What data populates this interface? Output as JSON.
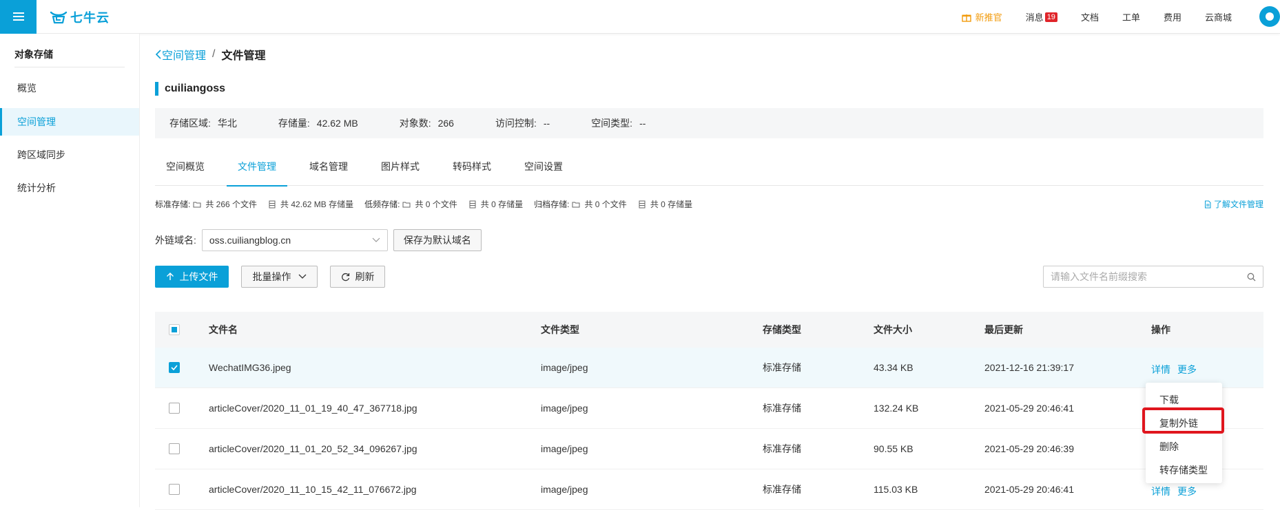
{
  "header": {
    "logo_text": "七牛云",
    "nav": [
      {
        "label": "新推官",
        "promo": true
      },
      {
        "label": "消息",
        "badge": "19"
      },
      {
        "label": "文档"
      },
      {
        "label": "工单"
      },
      {
        "label": "费用"
      },
      {
        "label": "云商城"
      }
    ]
  },
  "sidebar": {
    "title": "对象存储",
    "items": [
      {
        "label": "概览",
        "active": false
      },
      {
        "label": "空间管理",
        "active": true
      },
      {
        "label": "跨区域同步",
        "active": false
      },
      {
        "label": "统计分析",
        "active": false
      }
    ]
  },
  "breadcrumb": {
    "parent": "空间管理",
    "separator": "/",
    "current": "文件管理"
  },
  "bucket": {
    "name": "cuiliangoss",
    "info": [
      {
        "label": "存储区域:",
        "value": "华北"
      },
      {
        "label": "存储量:",
        "value": "42.62 MB"
      },
      {
        "label": "对象数:",
        "value": "266"
      },
      {
        "label": "访问控制:",
        "value": "--"
      },
      {
        "label": "空间类型:",
        "value": "--"
      }
    ]
  },
  "tabs": [
    {
      "label": "空间概览",
      "active": false
    },
    {
      "label": "文件管理",
      "active": true
    },
    {
      "label": "域名管理",
      "active": false
    },
    {
      "label": "图片样式",
      "active": false
    },
    {
      "label": "转码样式",
      "active": false
    },
    {
      "label": "空间设置",
      "active": false
    }
  ],
  "stats": {
    "standard_label": "标准存储:",
    "standard_files": "共 266 个文件",
    "standard_size": "共 42.62 MB 存储量",
    "lowfreq_label": "低频存储:",
    "lowfreq_files": "共 0 个文件",
    "lowfreq_size": "共 0 存储量",
    "archive_label": "归档存储:",
    "archive_files": "共 0 个文件",
    "archive_size": "共 0 存储量",
    "learn_link": "了解文件管理"
  },
  "domain": {
    "label": "外链域名:",
    "value": "oss.cuiliangblog.cn",
    "save_button": "保存为默认域名"
  },
  "toolbar": {
    "upload": "上传文件",
    "batch": "批量操作",
    "refresh": "刷新",
    "search_placeholder": "请输入文件名前缀搜索"
  },
  "table": {
    "headers": [
      "文件名",
      "文件类型",
      "存储类型",
      "文件大小",
      "最后更新",
      "操作"
    ],
    "rows": [
      {
        "name": "WechatIMG36.jpeg",
        "type": "image/jpeg",
        "storage": "标准存储",
        "size": "43.34 KB",
        "updated": "2021-12-16 21:39:17",
        "checked": true
      },
      {
        "name": "articleCover/2020_11_01_19_40_47_367718.jpg",
        "type": "image/jpeg",
        "storage": "标准存储",
        "size": "132.24 KB",
        "updated": "2021-05-29 20:46:41",
        "checked": false
      },
      {
        "name": "articleCover/2020_11_01_20_52_34_096267.jpg",
        "type": "image/jpeg",
        "storage": "标准存储",
        "size": "90.55 KB",
        "updated": "2021-05-29 20:46:39",
        "checked": false
      },
      {
        "name": "articleCover/2020_11_10_15_42_11_076672.jpg",
        "type": "image/jpeg",
        "storage": "标准存储",
        "size": "115.03 KB",
        "updated": "2021-05-29 20:46:41",
        "checked": false
      }
    ],
    "op_detail": "详情",
    "op_more": "更多"
  },
  "dropdown": {
    "items": [
      "下载",
      "复制外链",
      "删除",
      "转存储类型"
    ],
    "highlighted": "复制外链"
  },
  "colors": {
    "accent": "#0aa0d8",
    "highlight": "#e0161e",
    "promo": "#f29b0c",
    "badge": "#e0252a"
  }
}
